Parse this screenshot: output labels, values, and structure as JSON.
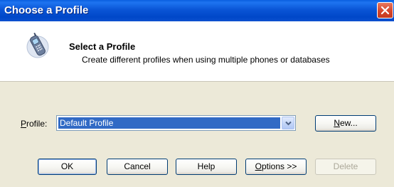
{
  "window": {
    "title": "Choose a Profile"
  },
  "header": {
    "title": "Select a Profile",
    "subtitle": "Create different profiles when using multiple phones or databases"
  },
  "profile": {
    "label_mnemonic": "P",
    "label_rest": "rofile:",
    "selected_value": "Default Profile"
  },
  "buttons": {
    "new_mnemonic": "N",
    "new_rest": "ew...",
    "ok": "OK",
    "cancel": "Cancel",
    "help": "Help",
    "options_mnemonic": "O",
    "options_rest": "ptions >>",
    "delete": "Delete"
  },
  "icons": {
    "close": "close-icon",
    "phone": "phone-icon",
    "dropdown": "chevron-down-icon"
  },
  "colors": {
    "titlebar": "#0a55d6",
    "selection": "#316ac5",
    "close_button": "#d5452b",
    "dialog_face": "#ece9d8"
  }
}
